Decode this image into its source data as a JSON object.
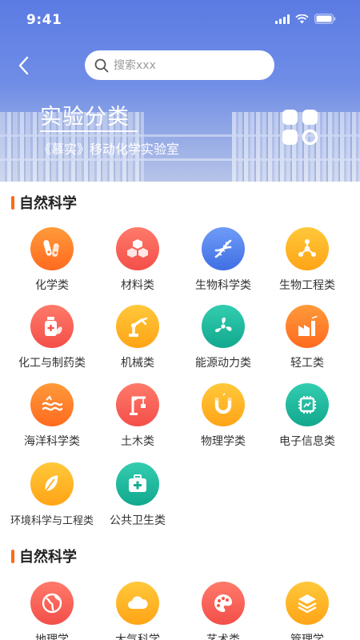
{
  "status_bar": {
    "time": "9:41"
  },
  "search": {
    "placeholder": "搜索xxx"
  },
  "hero": {
    "title": "实验分类",
    "subtitle": "《慕实》移动化学实验室"
  },
  "sections": [
    {
      "title": "自然科学",
      "items": [
        {
          "label": "化学类",
          "color": "#ff7a26",
          "icon": "test-tube-icon"
        },
        {
          "label": "材料类",
          "color": "#f4564c",
          "icon": "cubes-icon"
        },
        {
          "label": "生物科学类",
          "color": "#4a78ea",
          "icon": "dna-icon"
        },
        {
          "label": "生物工程类",
          "color": "#ffab1c",
          "icon": "molecule-icon"
        },
        {
          "label": "化工与制药类",
          "color": "#f4564c",
          "icon": "medicine-bottle-icon"
        },
        {
          "label": "机械类",
          "color": "#ffab1c",
          "icon": "robot-arm-icon"
        },
        {
          "label": "能源动力类",
          "color": "#16ad92",
          "icon": "fan-icon"
        },
        {
          "label": "轻工类",
          "color": "#ff7a26",
          "icon": "factory-icon"
        },
        {
          "label": "海洋科学类",
          "color": "#ff7a26",
          "icon": "ocean-icon"
        },
        {
          "label": "土木类",
          "color": "#f4564c",
          "icon": "crane-icon"
        },
        {
          "label": "物理学类",
          "color": "#ffab1c",
          "icon": "magnet-icon"
        },
        {
          "label": "电子信息类",
          "color": "#16ad92",
          "icon": "chip-icon"
        },
        {
          "label": "环境科学与工程类",
          "color": "#ffab1c",
          "icon": "leaf-icon"
        },
        {
          "label": "公共卫生类",
          "color": "#16ad92",
          "icon": "first-aid-icon"
        }
      ]
    },
    {
      "title": "自然科学",
      "items": [
        {
          "label": "地理学",
          "color": "#f4564c",
          "icon": "globe-icon"
        },
        {
          "label": "大气科学",
          "color": "#ffab1c",
          "icon": "cloud-icon"
        },
        {
          "label": "艺术类",
          "color": "#f4564c",
          "icon": "palette-icon"
        },
        {
          "label": "管理学",
          "color": "#ffab1c",
          "icon": "layers-icon"
        }
      ]
    }
  ]
}
